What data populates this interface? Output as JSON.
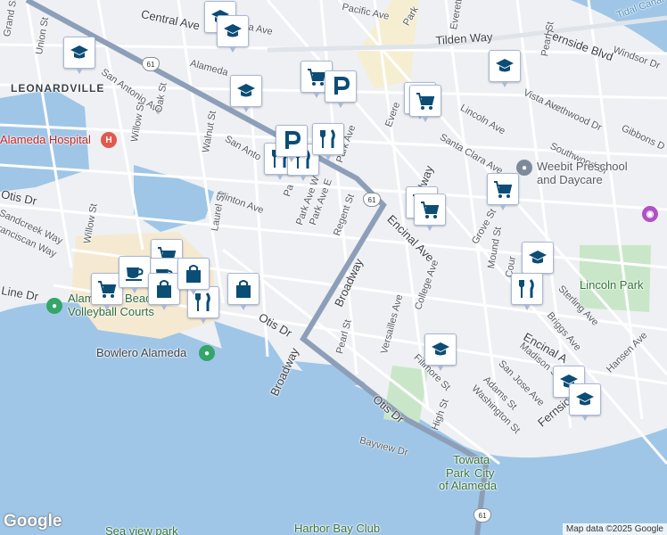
{
  "attribution": "Map data ©2025 Google",
  "logo": "Google",
  "colors": {
    "water": "#9fc6e7",
    "land": "#eef0f3",
    "road": "#ffffff",
    "highway": "#8d9fb8",
    "park": "#c9e6c9",
    "sand": "#f5ead1",
    "pin_icon": "#0b4d75"
  },
  "streets": {
    "grand": "Grand St",
    "union": "Union St",
    "central_w": "Central Ave",
    "central_e": "Centra",
    "clara": "lara Ave",
    "pacific": "Pacific Ave",
    "park_top": "Park",
    "everett": "Everett St",
    "tilden": "Tilden Way",
    "fernside": "Fernside Blvd",
    "windsor": "Windsor Dr",
    "san_antonio": "San Antonio Ave",
    "alameda": "Alameda",
    "oak": "Oak St",
    "walnut": "Walnut St",
    "willow": "Willow St",
    "san_anto2": "San Anto",
    "park_ave": "Park Ave",
    "everett2": "Evere",
    "lincoln": "Lincoln Ave",
    "northwood": "Northwood Dr",
    "vista": "Vista Ave",
    "gibbons": "Gibbons D",
    "santa_clara": "Santa Clara Ave",
    "southwood": "Southwood Dr",
    "pearl_top": "Pearl St",
    "otis_w": "Otis Dr",
    "sandcreek": "Sandcreek Way",
    "willow2": "Willow St",
    "clinton": "Clinton Ave",
    "laurel": "Laurel St",
    "park_w": "Park Ave W",
    "park_e": "Park Ave E",
    "pa": "Pa",
    "regent": "Regent St",
    "broadway_n": "Broadway",
    "encinal": "Encinal Ave",
    "grove": "Grove St",
    "mound": "Mound St",
    "court": "Cour",
    "sterling": "Sterling Ave",
    "franciscan": "ranciscan Way",
    "line": "Line Dr",
    "otis_mid": "Otis Dr",
    "broadway_mid": "Broadway",
    "pearl": "Pearl St",
    "versailles": "Versailles Ave",
    "college": "College Ave",
    "briggs": "Briggs Ave",
    "encinal2": "Encinal A",
    "madison": "Madison S",
    "san_jose": "San Jose Ave",
    "fillmore": "Fillmore St",
    "adams": "Adams St",
    "washington": "Washington St",
    "hansen": "Hansen Ave",
    "fernside2": "Fernside",
    "broadway_s": "Broadway",
    "otis_s": "Otis Dr",
    "high": "High St",
    "bayview": "Bayview Dr"
  },
  "routes": {
    "r1": "61",
    "r2": "61",
    "r3": "61"
  },
  "areas": {
    "leonardville": "LEONARDVILLE",
    "tidal_canal": "Tidal Canal"
  },
  "places": {
    "hospital": "Alameda Hospital",
    "beach_a": "Alam",
    "beach_b": "Beac",
    "volleyball": "Volleyball Courts",
    "bowlero": "Bowlero Alameda",
    "weebit_1": "Weebit Preschool",
    "weebit_2": "and Daycare",
    "lincoln_park": "Lincoln Park",
    "towata_1": "Towata",
    "towata_2": "Park",
    "towata_3": "City",
    "towata_4": "of Alameda",
    "seaview": "Sea view park",
    "harbor": "Harbor Bay Club"
  },
  "pins": [
    {
      "type": "school"
    },
    {
      "type": "school"
    },
    {
      "type": "school"
    },
    {
      "type": "school"
    },
    {
      "type": "school"
    },
    {
      "type": "school"
    },
    {
      "type": "school"
    },
    {
      "type": "school"
    },
    {
      "type": "school"
    },
    {
      "type": "shop"
    },
    {
      "type": "shop"
    },
    {
      "type": "shop"
    },
    {
      "type": "shop"
    },
    {
      "type": "shop"
    },
    {
      "type": "shop"
    },
    {
      "type": "shop"
    },
    {
      "type": "shop"
    },
    {
      "type": "restaurant"
    },
    {
      "type": "restaurant"
    },
    {
      "type": "restaurant"
    },
    {
      "type": "restaurant"
    },
    {
      "type": "restaurant"
    },
    {
      "type": "parking"
    },
    {
      "type": "parking"
    },
    {
      "type": "cafe"
    },
    {
      "type": "cafe"
    },
    {
      "type": "bag"
    },
    {
      "type": "bag"
    },
    {
      "type": "bag"
    }
  ]
}
